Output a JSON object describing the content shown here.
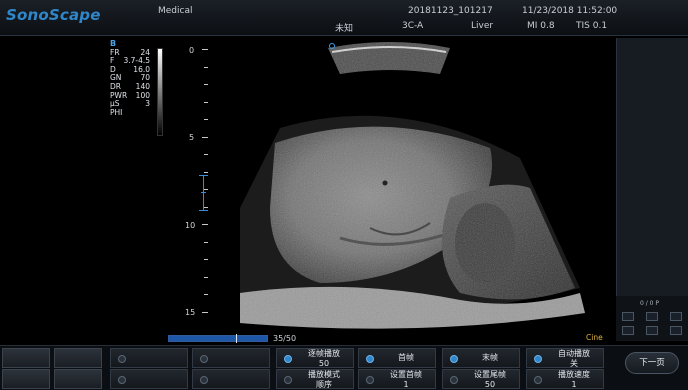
{
  "header": {
    "logo": "SonoScape",
    "hospital": "Medical",
    "patient_id": "20181123_101217",
    "datetime": "11/23/2018 11:52:00",
    "patient_name": "未知",
    "probe": "3C-A",
    "preset": "Liver",
    "mi": "MI 0.8",
    "tis": "TIS 0.1"
  },
  "params": {
    "mode": "B",
    "rows": [
      {
        "k": "FR",
        "v": "24"
      },
      {
        "k": "F",
        "v": "3.7-4.5"
      },
      {
        "k": "D",
        "v": "16.0"
      },
      {
        "k": "GN",
        "v": "70"
      },
      {
        "k": "DR",
        "v": "140"
      },
      {
        "k": "PWR",
        "v": "100"
      },
      {
        "k": "μS",
        "v": "3"
      },
      {
        "k": "PHI",
        "v": ""
      }
    ]
  },
  "depth_labels": [
    "0",
    "5",
    "10",
    "15"
  ],
  "cine": {
    "count": "35/50",
    "label": "Cine",
    "position": 0.68
  },
  "right_panel": {
    "label": "0 / 0 P"
  },
  "bottom": {
    "knobs": [
      {
        "line1": "逐帧播放",
        "line2": "50",
        "active": true
      },
      {
        "line1": "首帧",
        "line2": "",
        "active": true
      },
      {
        "line1": "末帧",
        "line2": "",
        "active": true
      },
      {
        "line1": "自动播放",
        "line2": "关",
        "active": true
      },
      {
        "line1": "播放模式",
        "line2": "顺序",
        "active": false
      },
      {
        "line1": "设置首帧",
        "line2": "1",
        "active": false
      },
      {
        "line1": "设置尾帧",
        "line2": "50",
        "active": false
      },
      {
        "line1": "播放速度",
        "line2": "1",
        "active": false
      }
    ],
    "next_label": "下一页"
  },
  "colors": {
    "accent": "#2f86c9",
    "cine_label": "#e0b33a"
  }
}
